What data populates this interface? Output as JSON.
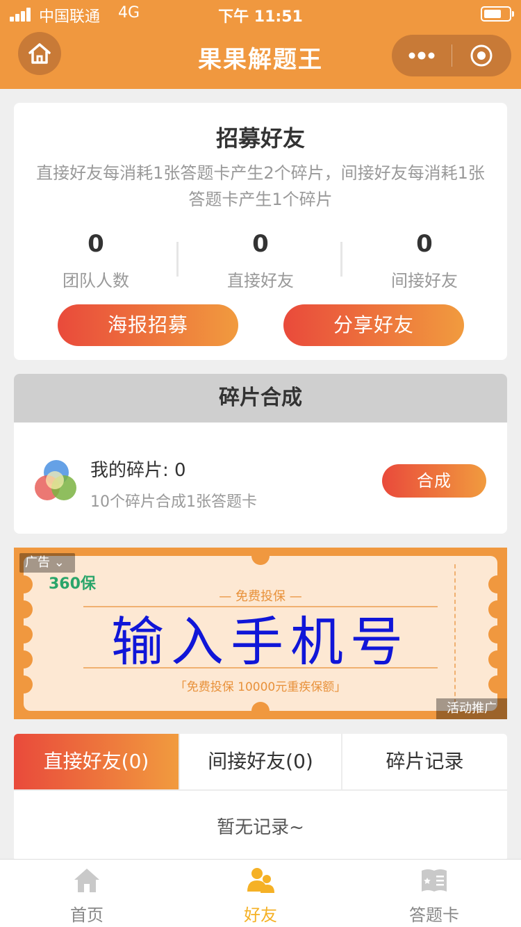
{
  "status_bar": {
    "carrier": "中国联通",
    "network": "4G",
    "time": "下午 11:51"
  },
  "nav": {
    "title": "果果解题王",
    "icons": [
      "home-icon",
      "more-dots-icon",
      "target-icon"
    ]
  },
  "recruit": {
    "title": "招募好友",
    "description": "直接好友每消耗1张答题卡产生2个碎片，间接好友每消耗1张答题卡产生1个碎片",
    "stats": [
      {
        "value": "0",
        "label": "团队人数"
      },
      {
        "value": "0",
        "label": "直接好友"
      },
      {
        "value": "0",
        "label": "间接好友"
      }
    ],
    "poster_label": "海报招募",
    "share_label": "分享好友"
  },
  "synthesis": {
    "title": "碎片合成",
    "my_fragments": "我的碎片: 0",
    "hint": "10个碎片合成1张答题卡",
    "compose_label": "合成"
  },
  "ad": {
    "tag": "广告",
    "brand": "360保",
    "subtitle": "— 免费投保 —",
    "headline": "输入手机号",
    "footnote": "「免费投保  10000元重疾保额」",
    "promo": "活动推广"
  },
  "tabs": {
    "items": [
      {
        "label": "直接好友(0)",
        "active": true
      },
      {
        "label": "间接好友(0)",
        "active": false
      },
      {
        "label": "碎片记录",
        "active": false
      }
    ],
    "empty_text": "暂无记录~"
  },
  "bottom_nav": {
    "items": [
      {
        "label": "首页",
        "icon": "house-icon",
        "active": false
      },
      {
        "label": "好友",
        "icon": "friends-icon",
        "active": true
      },
      {
        "label": "答题卡",
        "icon": "card-book-icon",
        "active": false
      }
    ]
  },
  "colors": {
    "brand_orange": "#f0983f",
    "gradient_start": "#e94a3b",
    "gradient_end": "#f19b3e",
    "active_nav": "#f5b126",
    "ad_headline": "#1016d8"
  }
}
